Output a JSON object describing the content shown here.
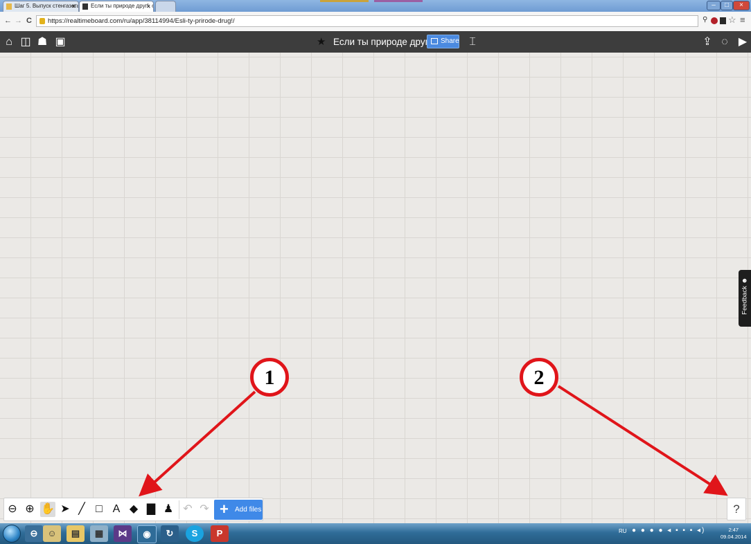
{
  "browser": {
    "tabs": [
      {
        "title": "Шаг 5. Выпуск стенгазеты",
        "close": "×",
        "active": false
      },
      {
        "title": "Если ты природе друг!, о",
        "close": "×",
        "active": true
      },
      {
        "title": "",
        "close": "",
        "active": false
      }
    ],
    "window_buttons": {
      "minimize": "–",
      "maximize": "□",
      "close": "×"
    },
    "nav": {
      "back": "←",
      "forward": "→",
      "reload": "C"
    },
    "url": "https://realtimeboard.com/ru/app/38114994/Esli-ty-prirode-drug!/",
    "extension_icons": [
      "search-icon",
      "adblock-icon",
      "extension-icon",
      "star-icon",
      "menu-icon"
    ]
  },
  "app": {
    "left_icons": [
      "home-icon",
      "boards-icon",
      "collaborators-icon",
      "image-icon"
    ],
    "board_title": "Если ты природе друг!",
    "share_label": "Share",
    "right_icons": [
      "export-icon",
      "chat-icon",
      "video-icon"
    ],
    "feedback_label": "Feedback ☻",
    "help_label": "?"
  },
  "toolbar": {
    "tools": [
      {
        "name": "zoom-out-icon",
        "glyph": "⊖"
      },
      {
        "name": "zoom-in-icon",
        "glyph": "⊕"
      },
      {
        "name": "hand-icon",
        "glyph": "✋"
      },
      {
        "name": "select-arrow-icon",
        "glyph": "➤"
      },
      {
        "name": "pen-icon",
        "glyph": "╱"
      },
      {
        "name": "rectangle-icon",
        "glyph": "□"
      },
      {
        "name": "text-icon",
        "glyph": "A"
      },
      {
        "name": "sticker-icon",
        "glyph": "◆"
      },
      {
        "name": "comment-icon",
        "glyph": "▇"
      },
      {
        "name": "user-icon",
        "glyph": "♟"
      },
      {
        "name": "undo-icon",
        "glyph": "↶"
      },
      {
        "name": "redo-icon",
        "glyph": "↷"
      }
    ],
    "add_files_label": "Add files",
    "add_files_plus": "+"
  },
  "annotations": {
    "badge_1": "1",
    "badge_2": "2",
    "color": "#e0151a"
  },
  "taskbar": {
    "language": "RU",
    "time": "2:47",
    "date": "09.04.2014",
    "apps": [
      "opera-icon",
      "chat-icon",
      "file-explorer-icon",
      "calculator-icon",
      "visual-studio-icon",
      "chrome-icon",
      "recycle-icon",
      "skype-icon",
      "powerpoint-icon"
    ]
  },
  "colors": {
    "app_bar": "#3d3d3d",
    "share_blue": "#4b8ae0",
    "add_files_blue": "#3f89e8",
    "canvas": "#ebe9e6"
  }
}
